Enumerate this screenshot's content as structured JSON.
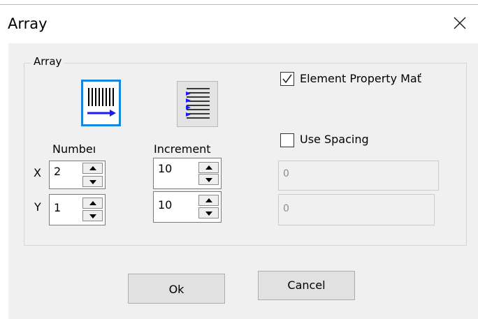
{
  "window": {
    "title": "Array",
    "close_icon": "close-icon"
  },
  "group": {
    "label": "Array",
    "mode_vertical_icon": "array-vertical-icon",
    "mode_horizontal_icon": "array-horizontal-icon",
    "colors": {
      "selected_border": "#1a86d9",
      "arrow_blue": "#1a1aff"
    }
  },
  "number": {
    "header": "Numbeı",
    "x_label": "X",
    "y_label": "Y",
    "x_value": "2",
    "y_value": "1"
  },
  "increment": {
    "header": "Increment",
    "x_value": "10",
    "y_value": "10"
  },
  "options": {
    "element_property_label": "Element Property Mať",
    "element_property_checked": true,
    "use_spacing_label": "Use Spacing",
    "use_spacing_checked": false,
    "spacing_x": "0",
    "spacing_y": "0"
  },
  "buttons": {
    "ok": "Ok",
    "cancel": "Cancel"
  }
}
